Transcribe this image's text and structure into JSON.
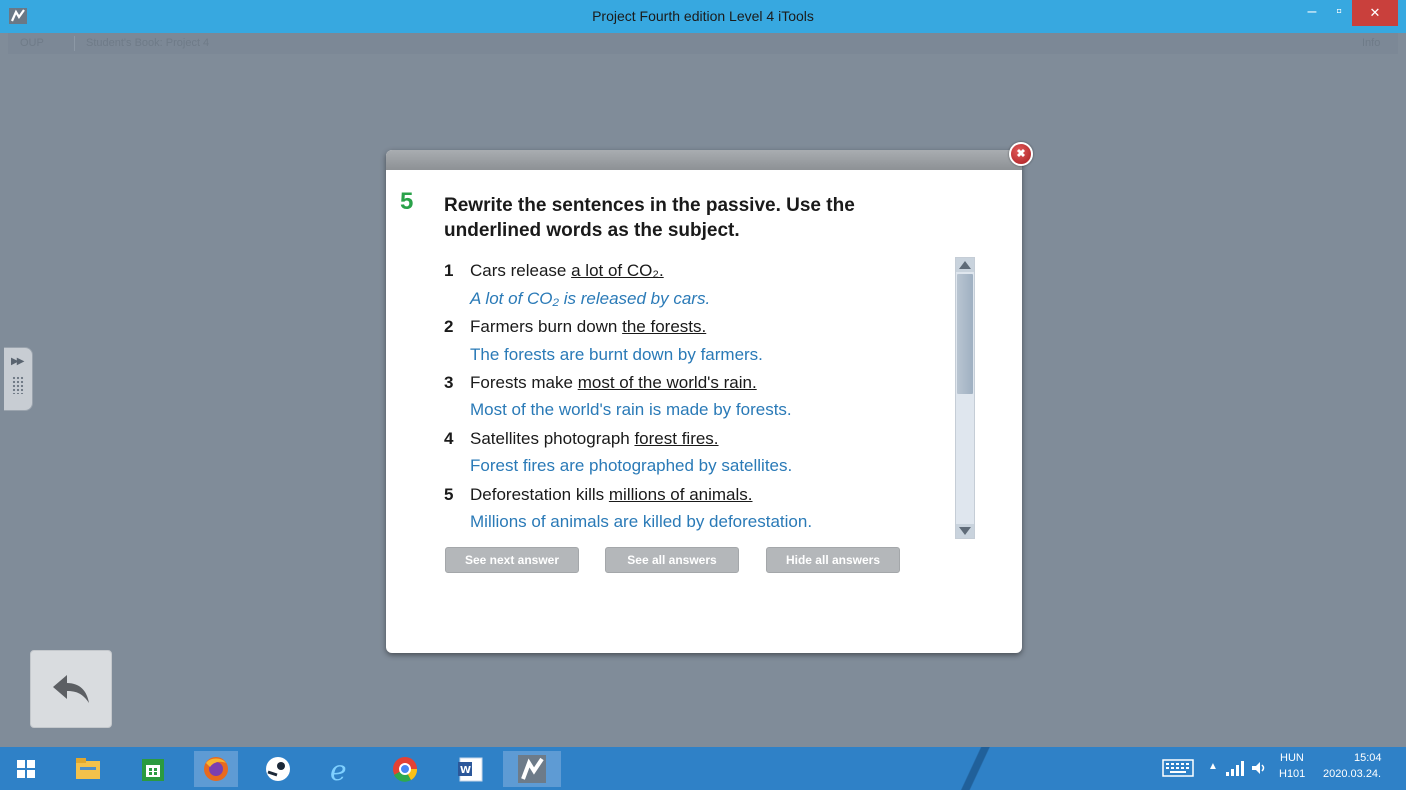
{
  "window": {
    "title": "Project Fourth edition Level 4 iTools",
    "minimize_label": "–",
    "maximize_label": "▫",
    "close_label": "✕"
  },
  "app_strip": {
    "left_label": "OUP",
    "breadcrumb": "Student's Book: Project 4",
    "right_label": "Info"
  },
  "exercise": {
    "number": "5",
    "instruction": "Rewrite the sentences in the passive. Use the underlined words as the subject.",
    "items": [
      {
        "num": "1",
        "prefix": "Cars release ",
        "underlined": "a lot of CO₂.",
        "answer": "A lot of CO₂ is released by cars."
      },
      {
        "num": "2",
        "prefix": "Farmers burn down ",
        "underlined": "the forests.",
        "answer": "The forests are burnt down by farmers."
      },
      {
        "num": "3",
        "prefix": "Forests make ",
        "underlined": "most of the world's rain.",
        "answer": "Most of the world's rain is made by forests."
      },
      {
        "num": "4",
        "prefix": "Satellites photograph ",
        "underlined": "forest fires.",
        "answer": "Forest fires are photographed by satellites."
      },
      {
        "num": "5",
        "prefix": "Deforestation kills ",
        "underlined": "millions of animals.",
        "answer": "Millions of animals are killed by deforestation."
      }
    ],
    "buttons": {
      "next": "See next answer",
      "all": "See all answers",
      "hide": "Hide all answers"
    }
  },
  "taskbar": {
    "apps": [
      "start-icon",
      "file-explorer-icon",
      "store-icon",
      "firefox-icon",
      "steam-icon",
      "internet-explorer-icon",
      "chrome-icon",
      "word-icon",
      "itools-icon"
    ],
    "tray": {
      "language": "HUN",
      "layout": "H101",
      "time": "15:04",
      "date": "2020.03.24."
    }
  },
  "colors": {
    "titlebar": "#37a8e0",
    "taskbar": "#2f81c7",
    "exercise_number": "#2aa24a",
    "answer_text": "#2a7ab7",
    "backdrop": "#808c99"
  }
}
